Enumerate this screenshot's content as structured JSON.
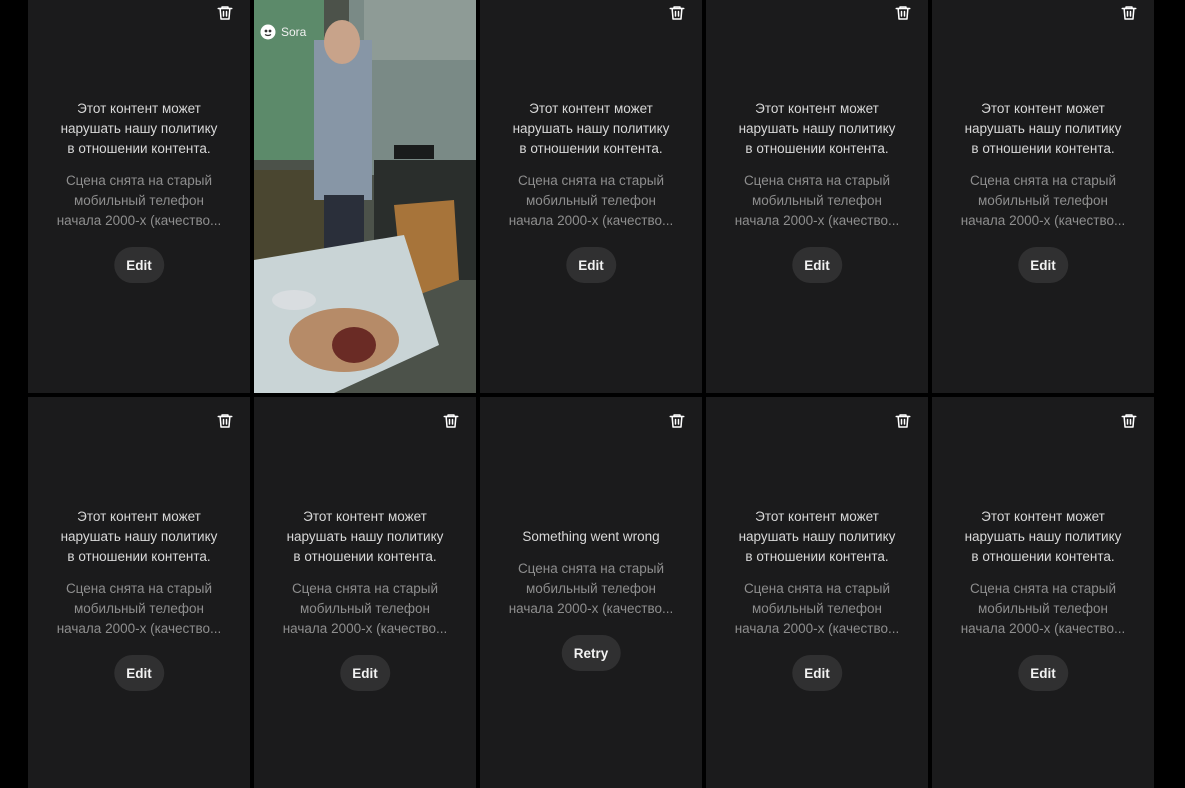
{
  "policy_message": "Этот контент может\nнарушать нашу политику\nв отношении контента.",
  "prompt_preview": "Сцена снята на старый\nмобильный телефон\nначала 2000-х (качество...",
  "edit_label": "Edit",
  "error_message": "Something went wrong",
  "retry_label": "Retry",
  "video_badge": "Sora",
  "colors": {
    "page_bg": "#000000",
    "card_bg": "#1b1b1c",
    "button_bg": "#303031",
    "primary_text": "#d8d8d8",
    "muted_text": "#8e8e8e"
  },
  "icons": {
    "delete": "trash-icon",
    "brand": "sora-logo-icon"
  }
}
